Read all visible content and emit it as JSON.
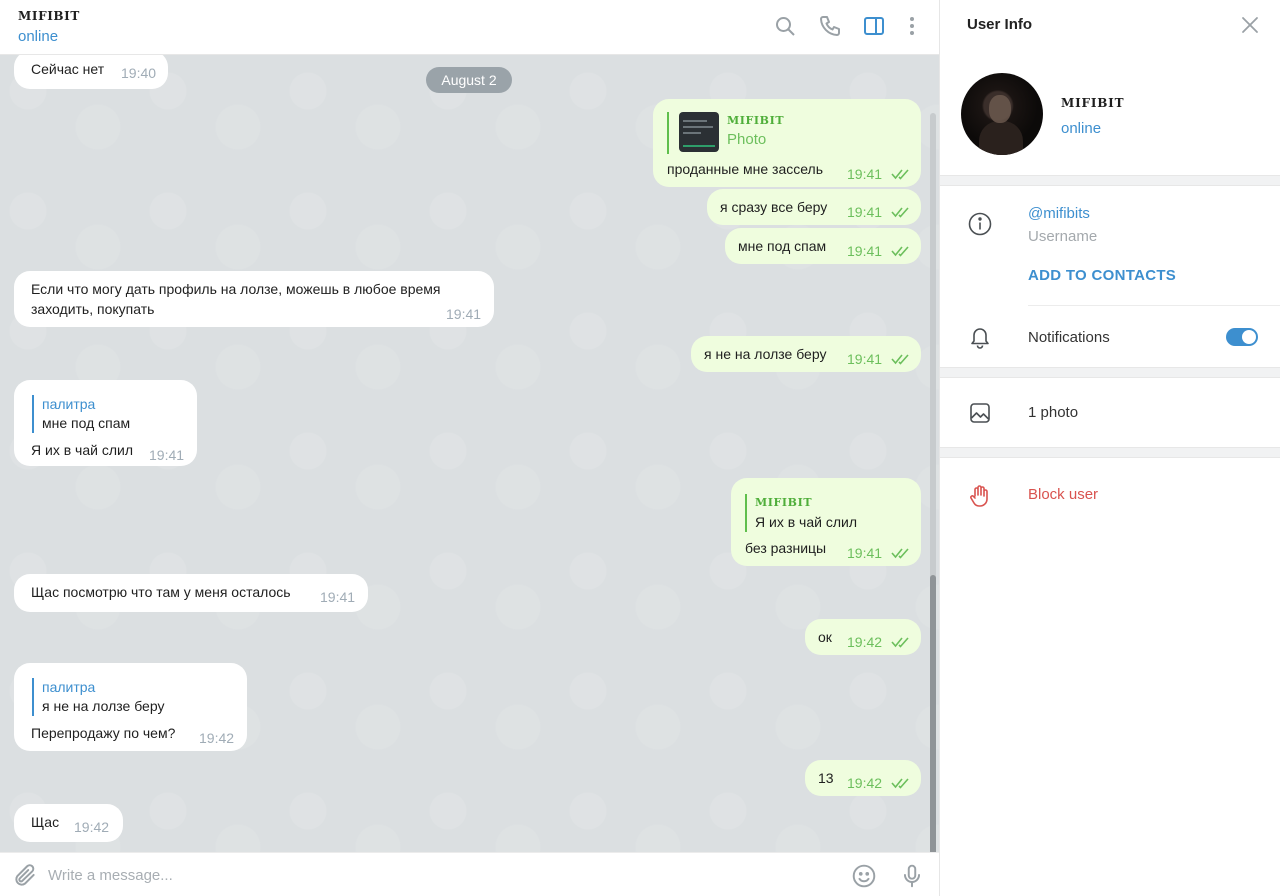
{
  "chat": {
    "peer_name": "MIFIBIT",
    "peer_status": "online",
    "date_label": "August 2",
    "composer_placeholder": "Write a message...",
    "messages": [
      {
        "text": "Сейчас нет",
        "time": "19:40"
      },
      {
        "reply_name": "MIFIBIT",
        "reply_text": "Photo",
        "text": "проданные мне зассель",
        "time": "19:41"
      },
      {
        "text": "я сразу все беру",
        "time": "19:41"
      },
      {
        "text": "мне под спам",
        "time": "19:41"
      },
      {
        "text_line1": "Если что могу дать профиль на лолзе, можешь в любое время",
        "text_line2": "заходить, покупать",
        "time": "19:41"
      },
      {
        "text": "я не на лолзе беру",
        "time": "19:41"
      },
      {
        "reply_name": "палитра",
        "reply_text": "мне под спам",
        "text": "Я их в чай слил",
        "time": "19:41"
      },
      {
        "reply_name": "MIFIBIT",
        "reply_text": "Я их в чай слил",
        "text": "без разницы",
        "time": "19:41"
      },
      {
        "text": "Щас посмотрю что там у меня осталось",
        "time": "19:41"
      },
      {
        "text": "ок",
        "time": "19:42"
      },
      {
        "reply_name": "палитра",
        "reply_text": "я не на лолзе беру",
        "text": "Перепродажу по чем?",
        "time": "19:42"
      },
      {
        "text": "13",
        "time": "19:42"
      },
      {
        "text": "Щас",
        "time": "19:42"
      }
    ]
  },
  "panel": {
    "title": "User Info",
    "name": "MIFIBIT",
    "status": "online",
    "username": "@mifibits",
    "username_label": "Username",
    "add_contacts": "ADD TO CONTACTS",
    "notifications_label": "Notifications",
    "notifications_on": true,
    "photos_label": "1 photo",
    "block_label": "Block user"
  },
  "colors": {
    "accent": "#3d8fcf",
    "outgoing_bubble": "#effdde",
    "chat_background": "#dbdfe1",
    "danger": "#d9534f"
  }
}
